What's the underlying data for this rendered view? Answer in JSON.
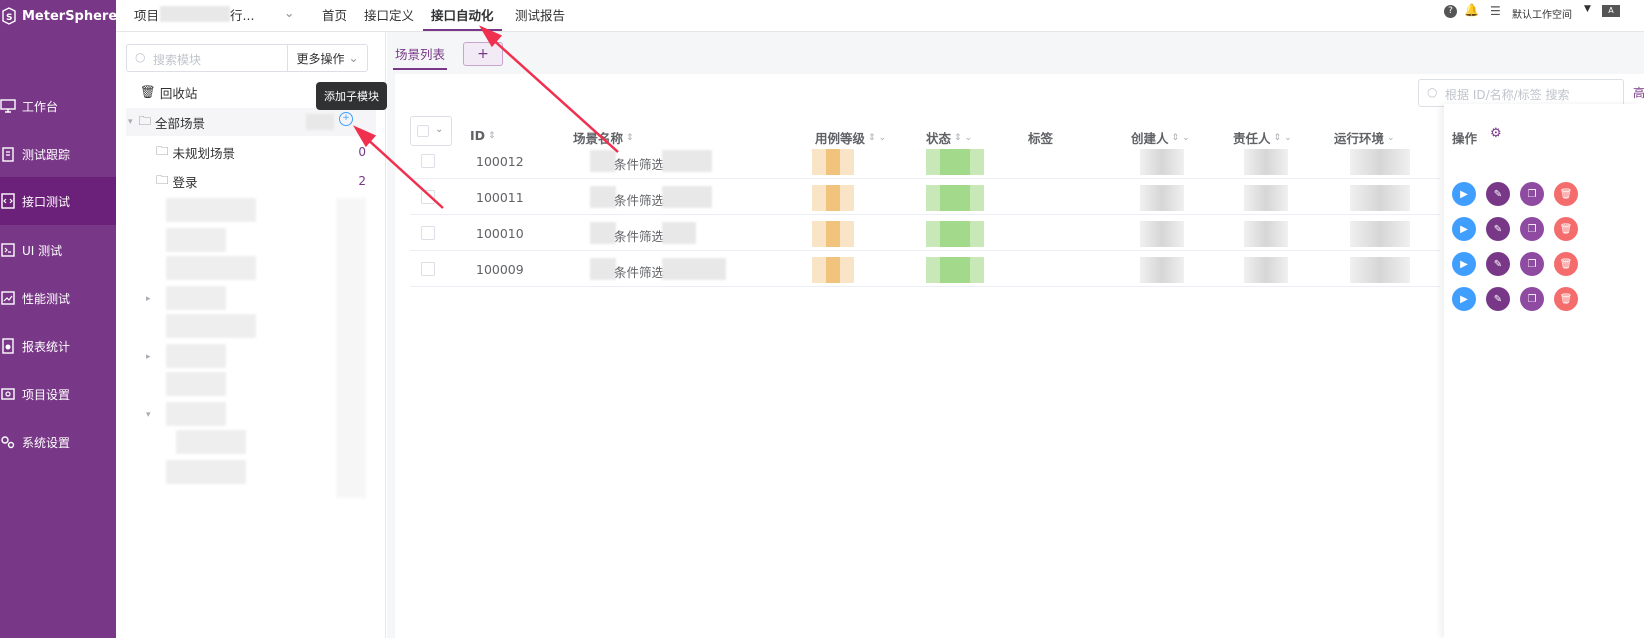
{
  "app": {
    "name": "MeterSphere"
  },
  "sidebar": {
    "items": [
      {
        "label": "工作台",
        "icon": "monitor-icon"
      },
      {
        "label": "测试跟踪",
        "icon": "clipboard-icon"
      },
      {
        "label": "接口测试",
        "icon": "api-doc-icon",
        "active": true
      },
      {
        "label": "UI 测试",
        "icon": "ui-test-icon"
      },
      {
        "label": "性能测试",
        "icon": "performance-icon"
      },
      {
        "label": "报表统计",
        "icon": "report-icon"
      },
      {
        "label": "项目设置",
        "icon": "project-settings-icon"
      },
      {
        "label": "系统设置",
        "icon": "system-settings-icon"
      }
    ]
  },
  "topbar": {
    "project_prefix": "项目",
    "project_suffix": "行...",
    "tabs": [
      {
        "label": "首页"
      },
      {
        "label": "接口定义"
      },
      {
        "label": "接口自动化",
        "active": true
      },
      {
        "label": "测试报告"
      }
    ],
    "workspace": "默认工作空间"
  },
  "tree": {
    "search_placeholder": "搜索模块",
    "more_ops": "更多操作",
    "recycle": "回收站",
    "all": "全部场景",
    "tooltip": "添加子模块",
    "nodes": [
      {
        "label": "未规划场景",
        "count": "0"
      },
      {
        "label": "登录",
        "count": "2"
      }
    ]
  },
  "main": {
    "tab_list": "场景列表",
    "tab_add": "+",
    "search_placeholder": "根据 ID/名称/标签 搜索",
    "advanced": "高",
    "columns": {
      "id": "ID",
      "name": "场景名称",
      "level": "用例等级",
      "status": "状态",
      "tags": "标签",
      "creator": "创建人",
      "owner": "责任人",
      "env": "运行环境",
      "ops": "操作"
    },
    "rows": [
      {
        "id": "100012",
        "name": "条件筛选"
      },
      {
        "id": "100011",
        "name": "条件筛选"
      },
      {
        "id": "100010",
        "name": "条件筛选"
      },
      {
        "id": "100009",
        "name": "条件筛选"
      }
    ]
  },
  "colors": {
    "brand": "#783887",
    "run": "#409eff",
    "delete": "#f56c6c",
    "arrow": "#f0304f"
  }
}
